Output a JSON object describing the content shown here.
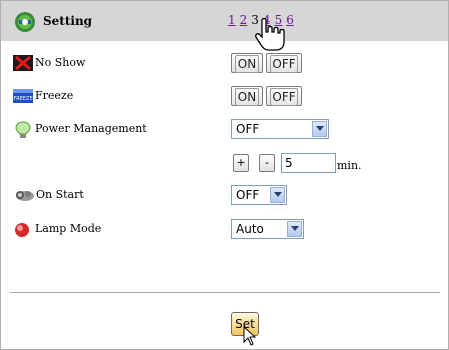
{
  "header": {
    "title": "Setting",
    "icon": "gear-settings-icon",
    "pages": [
      {
        "label": "1",
        "current": false
      },
      {
        "label": "2",
        "current": false
      },
      {
        "label": "3",
        "current": true
      },
      {
        "label": "4",
        "current": false
      },
      {
        "label": "5",
        "current": false
      },
      {
        "label": "6",
        "current": false
      }
    ]
  },
  "rows": {
    "no_show": {
      "label": "No Show",
      "icon": "no-show-icon",
      "on_label": "ON",
      "off_label": "OFF"
    },
    "freeze": {
      "label": "Freeze",
      "icon": "freeze-icon",
      "icon_text": "FREEZE",
      "on_label": "ON",
      "off_label": "OFF"
    },
    "power_management": {
      "label": "Power Management",
      "icon": "lightbulb-icon",
      "value": "OFF",
      "plus_label": "+",
      "minus_label": "-",
      "minutes_value": "5",
      "minutes_unit": "min."
    },
    "on_start": {
      "label": "On Start",
      "icon": "projector-icon",
      "value": "OFF"
    },
    "lamp_mode": {
      "label": "Lamp Mode",
      "icon": "lamp-icon",
      "value": "Auto"
    }
  },
  "footer": {
    "set_label": "Set"
  },
  "colors": {
    "header_bg": "#d6d6d6",
    "link": "#6a1a9a",
    "set_button": "#f2c45a"
  }
}
